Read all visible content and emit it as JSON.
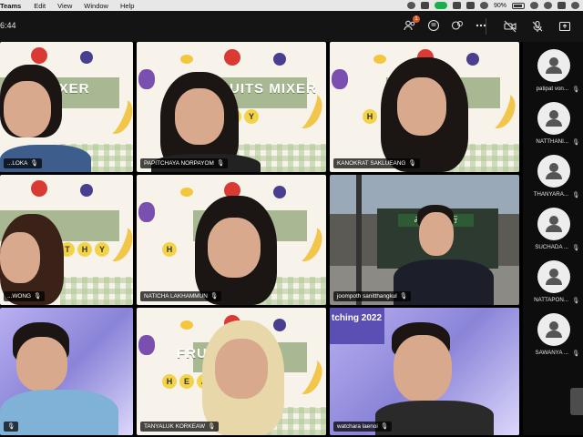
{
  "menubar": {
    "app_name": "Teams",
    "menus": [
      "Edit",
      "View",
      "Window",
      "Help"
    ],
    "battery": "90%"
  },
  "topbar": {
    "timer": "6:44",
    "notification_count": "1"
  },
  "tiles": [
    {
      "name": "...LOKA"
    },
    {
      "name": "PAPITCHAYA NORPAYOM"
    },
    {
      "name": "KANOKRAT SAKLUEANG"
    },
    {
      "name": "...WONG"
    },
    {
      "name": "NATICHA LAKHAMMUN"
    },
    {
      "name": "joompoth sanitthangkul"
    },
    {
      "name": ""
    },
    {
      "name": "TANYALUK KORKEAW"
    },
    {
      "name": "watchara laenoi"
    }
  ],
  "slide": {
    "title_a": "MIXER",
    "title_b": "FRUITS MIXER",
    "title_c": "FRU",
    "letters": [
      "H",
      "E",
      "A",
      "L",
      "T",
      "H",
      "Y"
    ],
    "letters_short": [
      "T",
      "H",
      "Y"
    ],
    "letters_heal": [
      "H",
      "E",
      "A"
    ]
  },
  "street_sign": "みちのく銀行",
  "purple_badge": "tching 2022",
  "sidebar": {
    "participants": [
      {
        "name": "patipat von..."
      },
      {
        "name": "NATTHANI..."
      },
      {
        "name": "THANYARA..."
      },
      {
        "name": "SUCHADA ..."
      },
      {
        "name": "NATTAPON..."
      },
      {
        "name": "SAWANYA ..."
      }
    ]
  }
}
